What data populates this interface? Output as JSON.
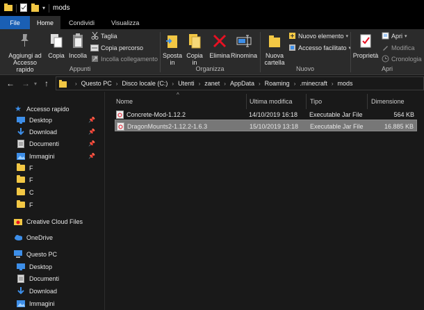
{
  "window": {
    "title": "mods"
  },
  "ribbon_tabs": [
    "File",
    "Home",
    "Condividi",
    "Visualizza"
  ],
  "ribbon": {
    "appunti": {
      "label": "Appunti",
      "pin": "Aggiungi ad\nAccesso rapido",
      "pin_l1": "Aggiungi ad",
      "pin_l2": "Accesso rapido",
      "copy": "Copia",
      "paste": "Incolla",
      "cut": "Taglia",
      "copy_path": "Copia percorso",
      "paste_shortcut": "Incolla collegamento"
    },
    "organizza": {
      "label": "Organizza",
      "move_l1": "Sposta",
      "move_l2": "in",
      "copyto_l1": "Copia",
      "copyto_l2": "in",
      "delete": "Elimina",
      "rename": "Rinomina"
    },
    "nuovo": {
      "label": "Nuovo",
      "newfolder_l1": "Nuova",
      "newfolder_l2": "cartella",
      "new_item": "Nuovo elemento",
      "easy_access": "Accesso facilitato"
    },
    "apri": {
      "label": "Apri",
      "properties": "Proprietà",
      "open": "Apri",
      "edit": "Modifica",
      "history": "Cronologia"
    }
  },
  "address": {
    "path": [
      "Questo PC",
      "Disco locale (C:)",
      "Utenti",
      "zanet",
      "AppData",
      "Roaming",
      ".minecraft",
      "mods"
    ]
  },
  "sidebar": {
    "quick_access": "Accesso rapido",
    "quick_items": [
      "Desktop",
      "Download",
      "Documenti",
      "Immagini",
      "F",
      "F",
      "C",
      "F"
    ],
    "creative_cloud": "Creative Cloud Files",
    "onedrive": "OneDrive",
    "this_pc": "Questo PC",
    "pc_items": [
      "Desktop",
      "Documenti",
      "Download",
      "Immagini"
    ]
  },
  "columns": {
    "name": "Nome",
    "modified": "Ultima modifica",
    "type": "Tipo",
    "size": "Dimensione"
  },
  "files": [
    {
      "name": "Concrete-Mod-1.12.2",
      "modified": "14/10/2019 16:18",
      "type": "Executable Jar File",
      "size": "564 KB"
    },
    {
      "name": "DragonMounts2-1.12.2-1.6.3",
      "modified": "15/10/2019 13:18",
      "type": "Executable Jar File",
      "size": "16.885 KB"
    }
  ],
  "colors": {
    "file_tab": "#1a5fb4",
    "folder": "#f2c744",
    "selection": "#777777",
    "delete_red": "#e81123",
    "blue_icon": "#3d8ee8"
  }
}
